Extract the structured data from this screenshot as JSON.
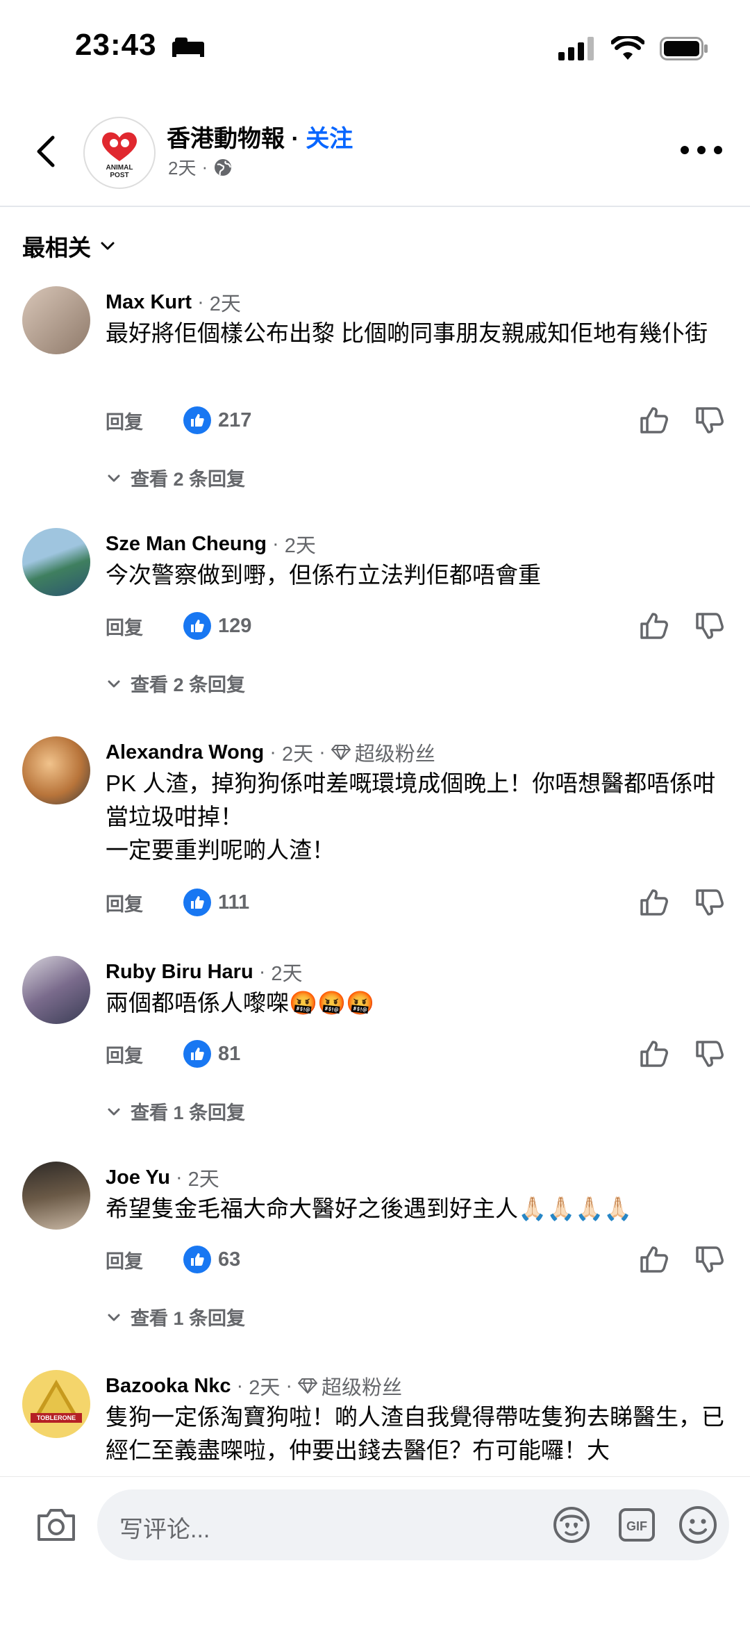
{
  "status": {
    "time": "23:43"
  },
  "header": {
    "page_name": "香港動物報",
    "separator": " · ",
    "follow_label": "关注",
    "post_age": "2天",
    "avatar_text_line1": "ANIMAL",
    "avatar_text_line2": "POST"
  },
  "sort": {
    "label": "最相关"
  },
  "comments": [
    {
      "name": "Max Kurt",
      "age": "2天",
      "badge": "",
      "text": "最好將佢個樣公布出黎 比個啲同事朋友親戚知佢地有幾仆街",
      "reply_label": "回复",
      "likes": "217",
      "view_replies": "查看 2 条回复",
      "avatar_color": "#b9a79a"
    },
    {
      "name": "Sze Man Cheung",
      "age": "2天",
      "badge": "",
      "text": "今次警察做到嘢，但係冇立法判佢都唔會重",
      "reply_label": "回复",
      "likes": "129",
      "view_replies": "查看 2 条回复",
      "avatar_color": "#5d8fa8"
    },
    {
      "name": "Alexandra Wong",
      "age": "2天",
      "badge": "超级粉丝",
      "text": "PK 人渣，掉狗狗係咁差嘅環境成個晚上！你唔想醫都唔係咁當垃圾咁掉！\n一定要重判呢啲人渣！",
      "reply_label": "回复",
      "likes": "111",
      "view_replies": "",
      "avatar_color": "#c98b4e"
    },
    {
      "name": "Ruby Biru Haru",
      "age": "2天",
      "badge": "",
      "text": "兩個都唔係人嚟㗎",
      "emoji": "🤬🤬🤬",
      "reply_label": "回复",
      "likes": "81",
      "view_replies": "查看 1 条回复",
      "avatar_color": "#8a7c9e"
    },
    {
      "name": "Joe Yu",
      "age": "2天",
      "badge": "",
      "text": "希望隻金毛福大命大醫好之後遇到好主人",
      "emoji": "🙏🏻🙏🏻🙏🏻🙏🏻",
      "reply_label": "回复",
      "likes": "63",
      "view_replies": "查看 1 条回复",
      "avatar_color": "#6e6253"
    },
    {
      "name": "Bazooka Nkc",
      "age": "2天",
      "badge": "超级粉丝",
      "text": "隻狗一定係淘寶狗啦！啲人渣自我覺得帶咗隻狗去睇醫生，已經仁至義盡㗎啦，仲要出錢去醫佢？冇可能囉！大",
      "reply_label": "",
      "likes": "",
      "view_replies": "",
      "avatar_color": "#e2b83a",
      "avatar_label": "TOBLERONE"
    }
  ],
  "input_bar": {
    "placeholder": "写评论..."
  },
  "colors": {
    "accent": "#0866ff",
    "like": "#1877f2",
    "secondary_text": "#65676b"
  }
}
